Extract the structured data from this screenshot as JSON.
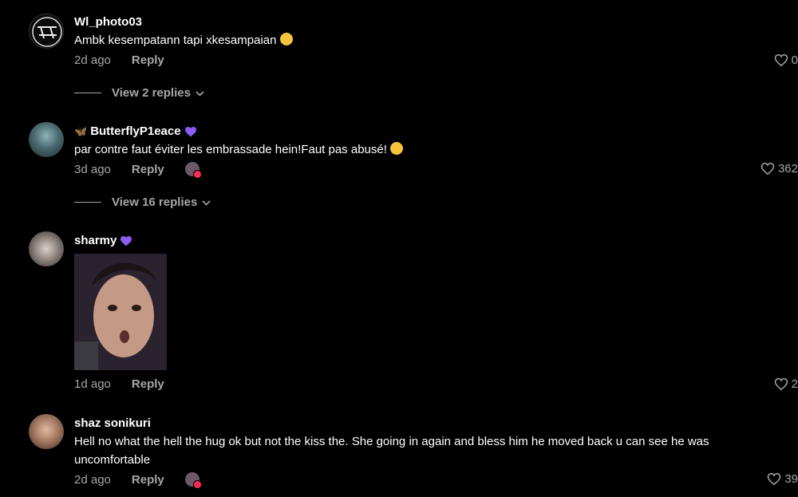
{
  "comments": [
    {
      "username": "Wl_photo03",
      "text": "Ambk kesempatann tapi xkesampaian",
      "time": "2d ago",
      "reply_label": "Reply",
      "likes": "0",
      "view_replies": "View 2 replies"
    },
    {
      "username": "ButterflyP1eace",
      "text": "par contre faut éviter les embrassade hein!Faut pas abusé!",
      "time": "3d ago",
      "reply_label": "Reply",
      "likes": "362",
      "view_replies": "View 16 replies"
    },
    {
      "username": "sharmy",
      "time": "1d ago",
      "reply_label": "Reply",
      "likes": "2"
    },
    {
      "username": "shaz sonikuri",
      "text": "Hell no what the hell the hug ok but not the kiss the. She going in again and bless him he moved back u can see he was uncomfortable",
      "time": "2d ago",
      "reply_label": "Reply",
      "likes": "39"
    }
  ],
  "colors": {
    "background": "#000000",
    "secondary_text": "#a6a6a6",
    "verified_heart": "#8b5cf6",
    "like_accent": "#fe2c55"
  }
}
